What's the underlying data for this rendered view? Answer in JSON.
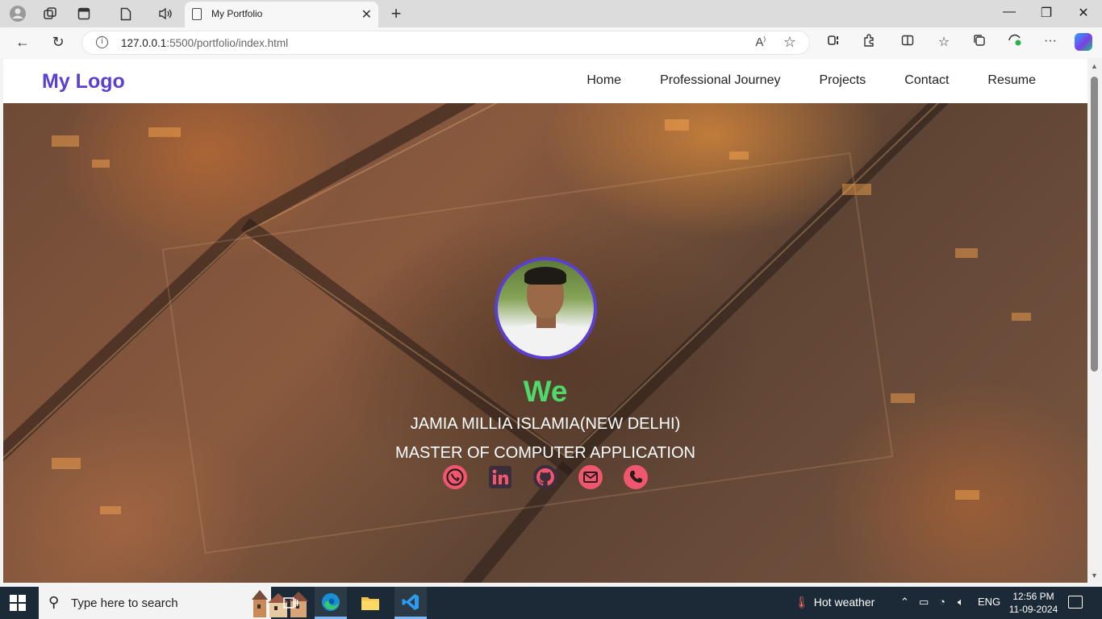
{
  "browser": {
    "tab_title": "My Portfolio",
    "url_host": "127.0.0.1",
    "url_rest": ":5500/portfolio/index.html"
  },
  "site": {
    "logo": "My Logo",
    "nav": [
      {
        "label": "Home"
      },
      {
        "label": "Professional Journey"
      },
      {
        "label": "Projects"
      },
      {
        "label": "Contact"
      },
      {
        "label": "Resume"
      }
    ],
    "hero": {
      "name": "We",
      "line1": "JAMIA MILLIA ISLAMIA(NEW DELHI)",
      "line2": "MASTER OF COMPUTER APPLICATION",
      "socials": [
        "whatsapp-icon",
        "linkedin-icon",
        "github-icon",
        "email-icon",
        "phone-icon"
      ]
    },
    "colors": {
      "brand": "#5b3fd1",
      "name_green": "#4ed96a",
      "social_pink": "#f0566e"
    }
  },
  "taskbar": {
    "search_placeholder": "Type here to search",
    "weather": "Hot weather",
    "lang": "ENG",
    "time": "12:56 PM",
    "date": "11-09-2024"
  }
}
